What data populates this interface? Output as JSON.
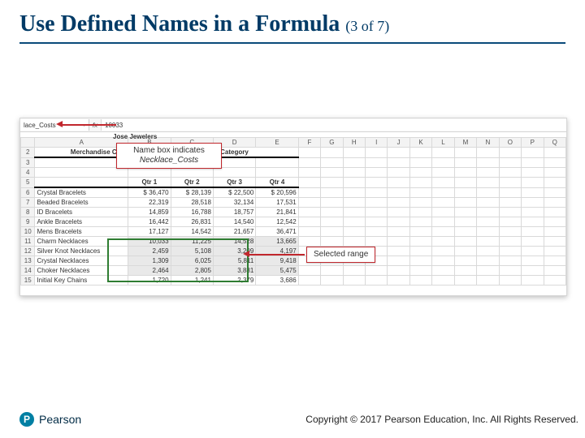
{
  "title": {
    "main": "Use Defined Names in a Formula",
    "pager": "(3 of 7)"
  },
  "callouts": {
    "namebox_line1": "Name box indicates",
    "namebox_line2": "Necklace_Costs",
    "selected": "Selected range"
  },
  "excel": {
    "namebox_value": "lace_Costs",
    "formula_value": "10033",
    "sheet_title": "Jose Jewelers",
    "column_letters": [
      "A",
      "B",
      "C",
      "D",
      "E",
      "F",
      "G",
      "H",
      "I",
      "J",
      "K",
      "L",
      "M",
      "N",
      "O",
      "P",
      "Q"
    ],
    "row2_merchandise": "Merchandise Cost",
    "row2_category": "s Category",
    "row5_headers": [
      "",
      "Qtr 1",
      "Qtr 2",
      "Qtr 3",
      "Qtr 4"
    ],
    "rows": [
      {
        "n": "6",
        "a": "Crystal Bracelets",
        "b": "$ 36,470",
        "c": "$ 28,139",
        "d": "$ 22,500",
        "e": "$ 20,596"
      },
      {
        "n": "7",
        "a": "Beaded Bracelets",
        "b": "22,319",
        "c": "28,518",
        "d": "32,134",
        "e": "17,531"
      },
      {
        "n": "8",
        "a": "ID Bracelets",
        "b": "14,859",
        "c": "16,788",
        "d": "18,757",
        "e": "21,841"
      },
      {
        "n": "9",
        "a": "Ankle Bracelets",
        "b": "16,442",
        "c": "26,831",
        "d": "14,540",
        "e": "12,542"
      },
      {
        "n": "10",
        "a": "Mens Bracelets",
        "b": "17,127",
        "c": "14,542",
        "d": "21,657",
        "e": "36,471"
      },
      {
        "n": "11",
        "a": "Charm Necklaces",
        "b": "10,033",
        "c": "11,225",
        "d": "14,528",
        "e": "13,665",
        "sel": true
      },
      {
        "n": "12",
        "a": "Silver Knot Necklaces",
        "b": "2,459",
        "c": "5,108",
        "d": "3,209",
        "e": "4,197",
        "sel": true
      },
      {
        "n": "13",
        "a": "Crystal Necklaces",
        "b": "1,309",
        "c": "6,025",
        "d": "5,811",
        "e": "9,418",
        "sel": true
      },
      {
        "n": "14",
        "a": "Choker Necklaces",
        "b": "2,464",
        "c": "2,805",
        "d": "3,881",
        "e": "5,475",
        "sel": true
      },
      {
        "n": "15",
        "a": "Initial Key Chains",
        "b": "1,720",
        "c": "1,241",
        "d": "2,379",
        "e": "3,686"
      }
    ]
  },
  "footer": {
    "brand": "Pearson",
    "copyright": "Copyright © 2017 Pearson Education, Inc. All Rights Reserved."
  }
}
